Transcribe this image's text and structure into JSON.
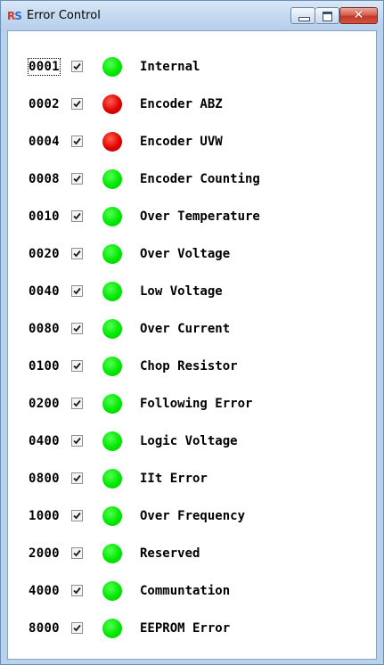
{
  "window": {
    "title": "Error Control",
    "close_glyph": "✕"
  },
  "colors": {
    "ok": "#00e000",
    "error": "#e00000"
  },
  "errors": [
    {
      "code": "0001",
      "label": "Internal",
      "checked": true,
      "status": "ok"
    },
    {
      "code": "0002",
      "label": "Encoder ABZ",
      "checked": true,
      "status": "error"
    },
    {
      "code": "0004",
      "label": "Encoder UVW",
      "checked": true,
      "status": "error"
    },
    {
      "code": "0008",
      "label": "Encoder Counting",
      "checked": true,
      "status": "ok"
    },
    {
      "code": "0010",
      "label": "Over Temperature",
      "checked": true,
      "status": "ok"
    },
    {
      "code": "0020",
      "label": "Over Voltage",
      "checked": true,
      "status": "ok"
    },
    {
      "code": "0040",
      "label": "Low Voltage",
      "checked": true,
      "status": "ok"
    },
    {
      "code": "0080",
      "label": "Over Current",
      "checked": true,
      "status": "ok"
    },
    {
      "code": "0100",
      "label": "Chop Resistor",
      "checked": true,
      "status": "ok"
    },
    {
      "code": "0200",
      "label": "Following Error",
      "checked": true,
      "status": "ok"
    },
    {
      "code": "0400",
      "label": "Logic Voltage",
      "checked": true,
      "status": "ok"
    },
    {
      "code": "0800",
      "label": "IIt Error",
      "checked": true,
      "status": "ok"
    },
    {
      "code": "1000",
      "label": "Over Frequency",
      "checked": true,
      "status": "ok"
    },
    {
      "code": "2000",
      "label": "Reserved",
      "checked": true,
      "status": "ok"
    },
    {
      "code": "4000",
      "label": "Communtation",
      "checked": true,
      "status": "ok"
    },
    {
      "code": "8000",
      "label": "EEPROM Error",
      "checked": true,
      "status": "ok"
    }
  ]
}
